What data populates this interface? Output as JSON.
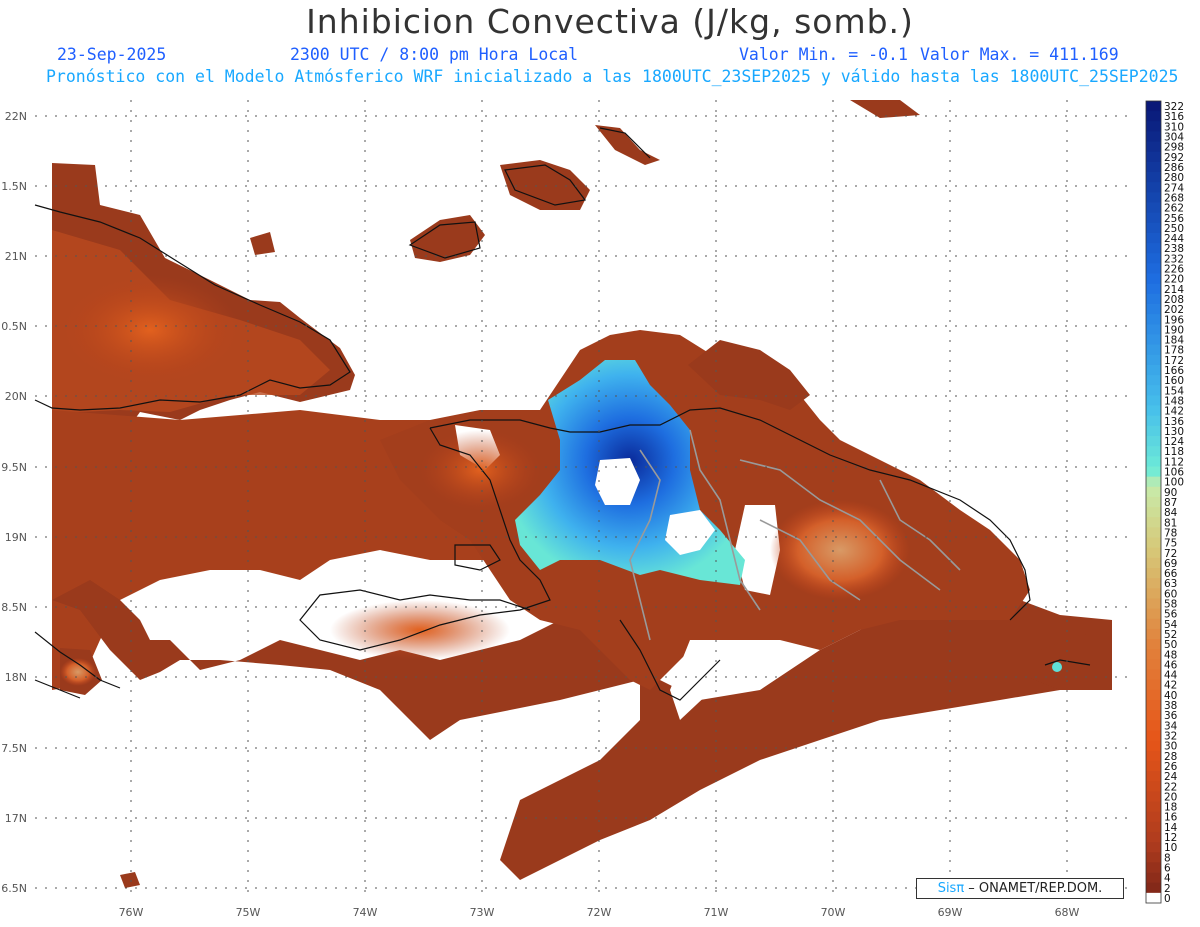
{
  "title": "Inhibicion Convectiva (J/kg, somb.)",
  "date": "23-Sep-2025",
  "time": "2300 UTC / 8:00 pm Hora Local",
  "valmin": "Valor Min. = -0.1",
  "valmax": "Valor Max. = 411.169",
  "forecast": "Pronóstico con el Modelo Atmósferico WRF inicializado a las 1800UTC_23SEP2025 y válido hasta las  1800UTC_25SEP2025",
  "credit": {
    "sis": "Sisπ",
    "rest": " – ONAMET/REP.DOM."
  },
  "lat_labels": [
    "22N",
    "1.5N",
    "21N",
    "0.5N",
    "20N",
    "9.5N",
    "19N",
    "8.5N",
    "18N",
    "7.5N",
    "17N",
    "6.5N"
  ],
  "lon_labels": [
    "76W",
    "75W",
    "74W",
    "73W",
    "72W",
    "71W",
    "70W",
    "69W",
    "68W"
  ],
  "colorbar_labels": [
    "322",
    "316",
    "310",
    "304",
    "298",
    "292",
    "286",
    "280",
    "274",
    "268",
    "262",
    "256",
    "250",
    "244",
    "238",
    "232",
    "226",
    "220",
    "214",
    "208",
    "202",
    "196",
    "190",
    "184",
    "178",
    "172",
    "166",
    "160",
    "154",
    "148",
    "142",
    "136",
    "130",
    "124",
    "118",
    "112",
    "106",
    "100",
    "90",
    "87",
    "84",
    "81",
    "78",
    "75",
    "72",
    "69",
    "66",
    "63",
    "60",
    "58",
    "56",
    "54",
    "52",
    "50",
    "48",
    "46",
    "44",
    "42",
    "40",
    "38",
    "36",
    "34",
    "32",
    "30",
    "28",
    "26",
    "24",
    "22",
    "20",
    "18",
    "16",
    "14",
    "12",
    "10",
    "8",
    "6",
    "4",
    "2",
    "0"
  ],
  "colors": {
    "land_base": "#8f3a1c",
    "warm": "#c5441a",
    "hot": "#e25a14",
    "cyan": "#5fe0d8",
    "blue": "#1e78e0",
    "navy": "#0a2a9a"
  }
}
